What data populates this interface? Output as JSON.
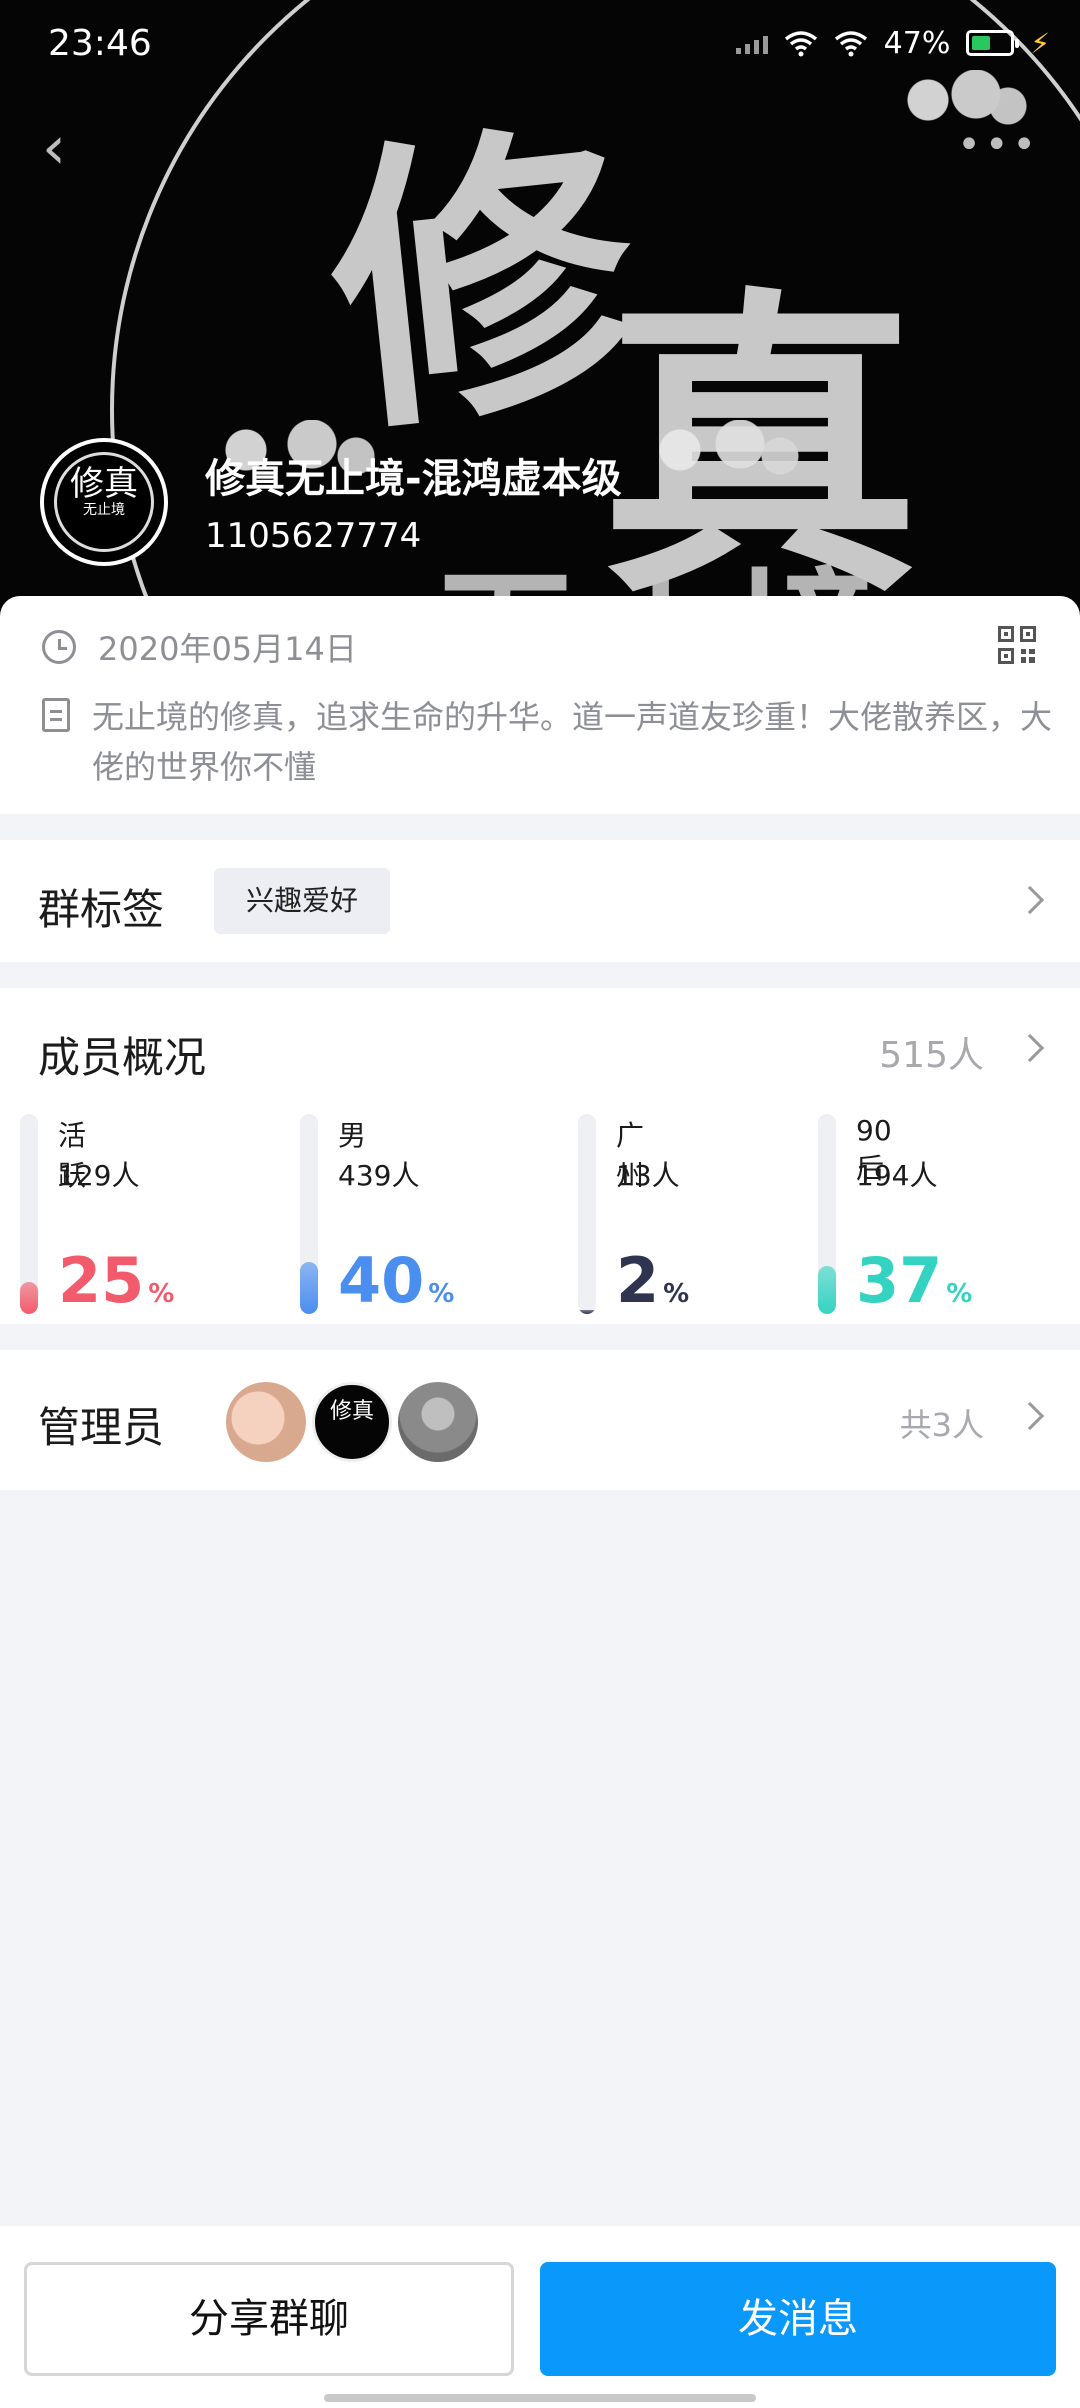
{
  "status_bar": {
    "time": "23:46",
    "battery": "47%"
  },
  "header": {
    "title": "修真无止境-混鸿虚本级",
    "group_id": "1105627774",
    "bg_chars": [
      "修",
      "真",
      "无止境"
    ],
    "avatar_text": "修真",
    "avatar_subtext": "无止境"
  },
  "info": {
    "date": "2020年05月14日",
    "description": "无止境的修真，追求生命的升华。道一声道友珍重！大佬散养区，大佬的世界你不懂"
  },
  "tags": {
    "title": "群标签",
    "items": [
      "兴趣爱好"
    ]
  },
  "members": {
    "title": "成员概况",
    "count": "515人",
    "stats": [
      {
        "label": "活跃",
        "sub": "129人",
        "percent": "25",
        "unit": "%",
        "color": "#f25b6b",
        "fill": 0.16
      },
      {
        "label": "男",
        "sub": "439人",
        "percent": "40",
        "unit": "%",
        "color": "#4a8ef0",
        "fill": 0.26
      },
      {
        "label": "广州",
        "sub": "13人",
        "percent": "2",
        "unit": "%",
        "color": "#2f3450",
        "fill": 0.02
      },
      {
        "label": "90后",
        "sub": "194人",
        "percent": "37",
        "unit": "%",
        "color": "#34d3c1",
        "fill": 0.24
      }
    ]
  },
  "admins": {
    "title": "管理员",
    "total": "共3人",
    "avatar_text": "修真"
  },
  "actions": {
    "share_label": "分享群聊",
    "send_label": "发消息"
  }
}
